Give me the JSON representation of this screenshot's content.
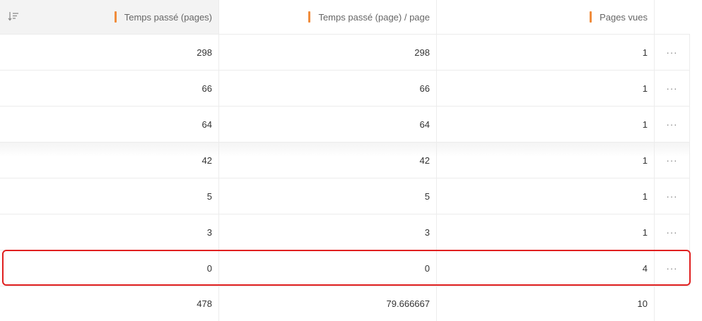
{
  "header": {
    "sort_icon": "sort-descending-icon",
    "columns": [
      "Temps passé (pages)",
      "Temps passé (page) / page",
      "Pages vues"
    ],
    "accent_color": "#f08c3c"
  },
  "rows": [
    {
      "time_pages": "298",
      "time_per_page": "298",
      "page_views": "1",
      "more": "···"
    },
    {
      "time_pages": "66",
      "time_per_page": "66",
      "page_views": "1",
      "more": "···"
    },
    {
      "time_pages": "64",
      "time_per_page": "64",
      "page_views": "1",
      "more": "···"
    },
    {
      "time_pages": "42",
      "time_per_page": "42",
      "page_views": "1",
      "more": "···"
    },
    {
      "time_pages": "5",
      "time_per_page": "5",
      "page_views": "1",
      "more": "···"
    },
    {
      "time_pages": "3",
      "time_per_page": "3",
      "page_views": "1",
      "more": "···"
    },
    {
      "time_pages": "0",
      "time_per_page": "0",
      "page_views": "4",
      "more": "···"
    }
  ],
  "totals": {
    "time_pages": "478",
    "time_per_page": "79.666667",
    "page_views": "10"
  },
  "highlight_color": "#e02020"
}
